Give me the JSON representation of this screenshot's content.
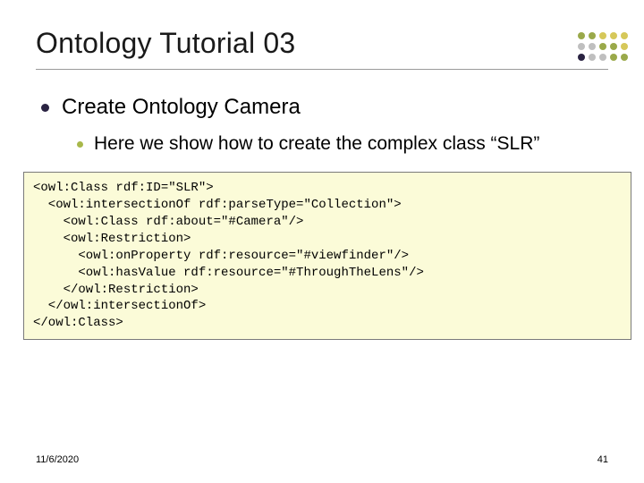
{
  "title": "Ontology Tutorial 03",
  "bullets": {
    "level1": "Create Ontology Camera",
    "level2": "Here we show how to create the complex class “SLR”"
  },
  "code": {
    "l1": "<owl:Class rdf:ID=\"SLR\">",
    "l2": "  <owl:intersectionOf rdf:parseType=\"Collection\">",
    "l3": "    <owl:Class rdf:about=\"#Camera\"/>",
    "l4": "    <owl:Restriction>",
    "l5": "      <owl:onProperty rdf:resource=\"#viewfinder\"/>",
    "l6": "      <owl:hasValue rdf:resource=\"#ThroughTheLens\"/>",
    "l7": "    </owl:Restriction>",
    "l8": "  </owl:intersectionOf>",
    "l9": "</owl:Class>"
  },
  "footer": {
    "date": "11/6/2020",
    "page": "41"
  },
  "deco_colors": {
    "olive": "#9aa94a",
    "gold": "#d6c85a",
    "grey": "#bfbfbf",
    "navy": "#2a2342"
  }
}
